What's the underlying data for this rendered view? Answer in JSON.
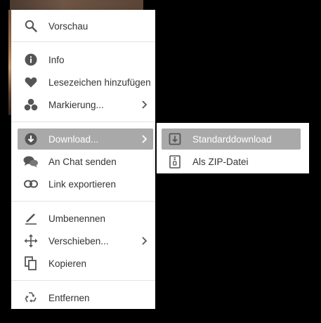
{
  "context_menu": {
    "items": [
      {
        "label": "Vorschau",
        "icon": "search-icon"
      },
      {
        "label": "Info",
        "icon": "info-icon"
      },
      {
        "label": "Lesezeichen hinzufügen",
        "icon": "heart-icon"
      },
      {
        "label": "Markierung...",
        "icon": "color-dots-icon",
        "has_submenu": true
      },
      {
        "label": "Download...",
        "icon": "download-icon",
        "has_submenu": true,
        "active": true
      },
      {
        "label": "An Chat senden",
        "icon": "chat-icon"
      },
      {
        "label": "Link exportieren",
        "icon": "link-icon"
      },
      {
        "label": "Umbenennen",
        "icon": "pen-icon"
      },
      {
        "label": "Verschieben...",
        "icon": "move-icon",
        "has_submenu": true
      },
      {
        "label": "Kopieren",
        "icon": "copy-icon"
      },
      {
        "label": "Entfernen",
        "icon": "recycle-icon"
      }
    ]
  },
  "download_submenu": {
    "items": [
      {
        "label": "Standarddownload",
        "icon": "download-file-icon",
        "active": true
      },
      {
        "label": "Als ZIP-Datei",
        "icon": "zip-file-icon"
      }
    ]
  },
  "colors": {
    "active_background": "#a9a9a9",
    "icon": "#555555",
    "text": "#333333",
    "separator": "#e4e4e4"
  }
}
